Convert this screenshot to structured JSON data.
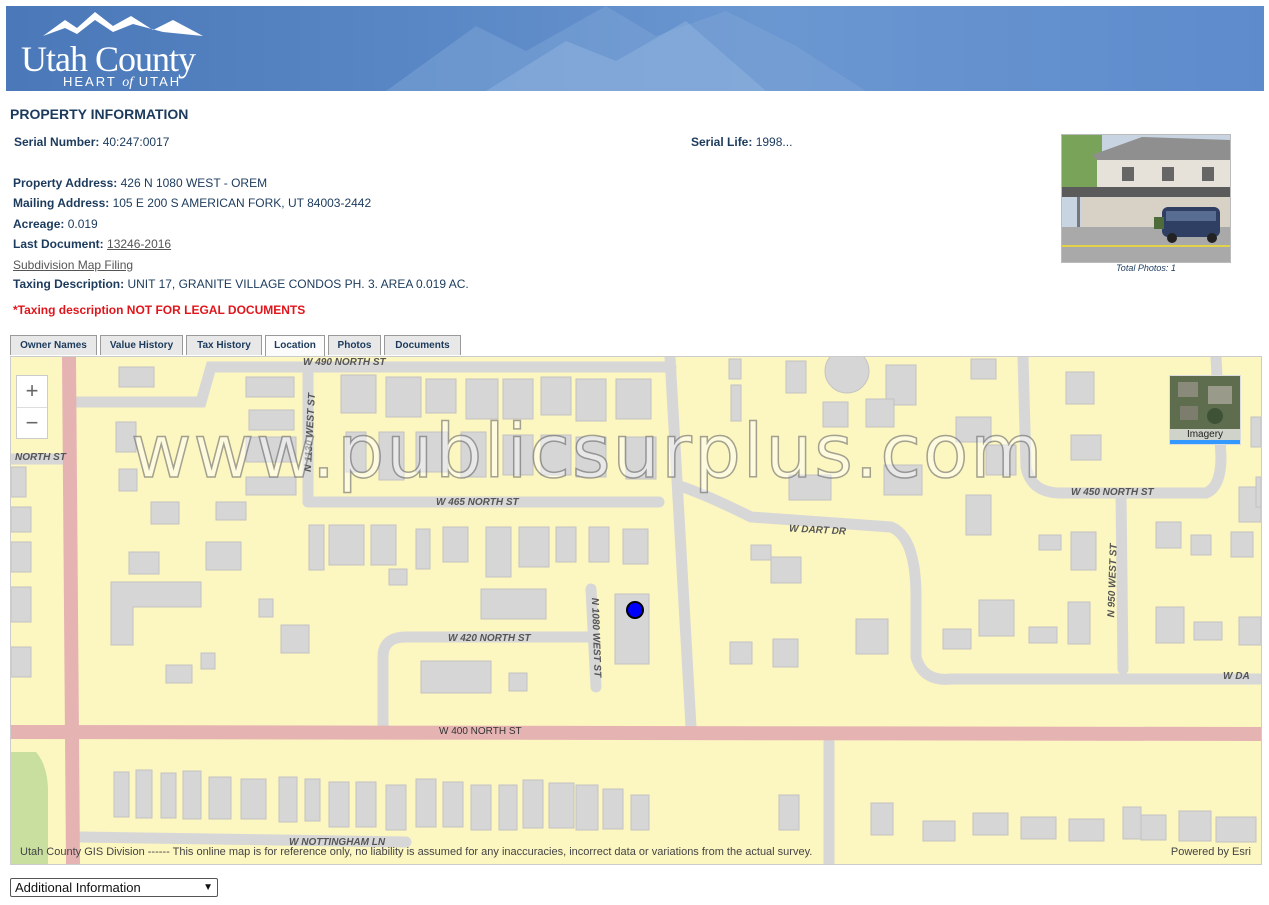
{
  "header": {
    "brand_title": "Utah County",
    "brand_sub_a": "HEART",
    "brand_sub_b": "of",
    "brand_sub_c": "UTAH"
  },
  "section_title": "PROPERTY INFORMATION",
  "property": {
    "serial_number_label": "Serial Number:",
    "serial_number": "40:247:0017",
    "serial_life_label": "Serial Life:",
    "serial_life": "1998...",
    "property_address_label": "Property Address:",
    "property_address": "426 N 1080 WEST - OREM",
    "mailing_address_label": "Mailing Address:",
    "mailing_address": "105 E 200 S AMERICAN FORK, UT 84003-2442",
    "acreage_label": "Acreage:",
    "acreage": "0.019",
    "last_document_label": "Last Document:",
    "last_document": "13246-2016",
    "subdivision_link": "Subdivision Map Filing",
    "taxing_description_label": "Taxing Description:",
    "taxing_description": "UNIT 17, GRANITE VILLAGE CONDOS PH. 3. AREA 0.019 AC.",
    "warning": "*Taxing description NOT FOR LEGAL DOCUMENTS",
    "photo_caption": "Total Photos: 1"
  },
  "tabs": [
    {
      "label": "Owner Names"
    },
    {
      "label": "Value History"
    },
    {
      "label": "Tax History"
    },
    {
      "label": "Location"
    },
    {
      "label": "Photos"
    },
    {
      "label": "Documents"
    }
  ],
  "active_tab": "Location",
  "map": {
    "zoom_in": "+",
    "zoom_out": "−",
    "imagery_label": "Imagery",
    "watermark": "www.publicsurplus.com",
    "attribution": "Utah County GIS Division ------ This online map is for reference only, no liability is assumed for any inaccuracies, incorrect data or variations from the actual survey.",
    "powered_by": "Powered by Esri",
    "streets": {
      "s490": "W 490 NORTH ST",
      "s1130": "N 1130 WEST ST",
      "north_st": "NORTH ST",
      "s465": "W 465 NORTH ST",
      "dart": "W DART DR",
      "s450": "W 450 NORTH ST",
      "s950": "N 950 WEST ST",
      "s1080": "N 1080 WEST ST",
      "s420": "W 420 NORTH ST",
      "wda": "W DA",
      "s400": "W 400 NORTH ST",
      "nottingham": "W NOTTINGHAM LN"
    },
    "colors": {
      "land": "#fcf6c1",
      "road": "#d7d7d7",
      "arterial": "#e6b3b3",
      "building": "#d6d6d6",
      "marker": "#0000ff"
    }
  },
  "additional_select": "Additional Information"
}
